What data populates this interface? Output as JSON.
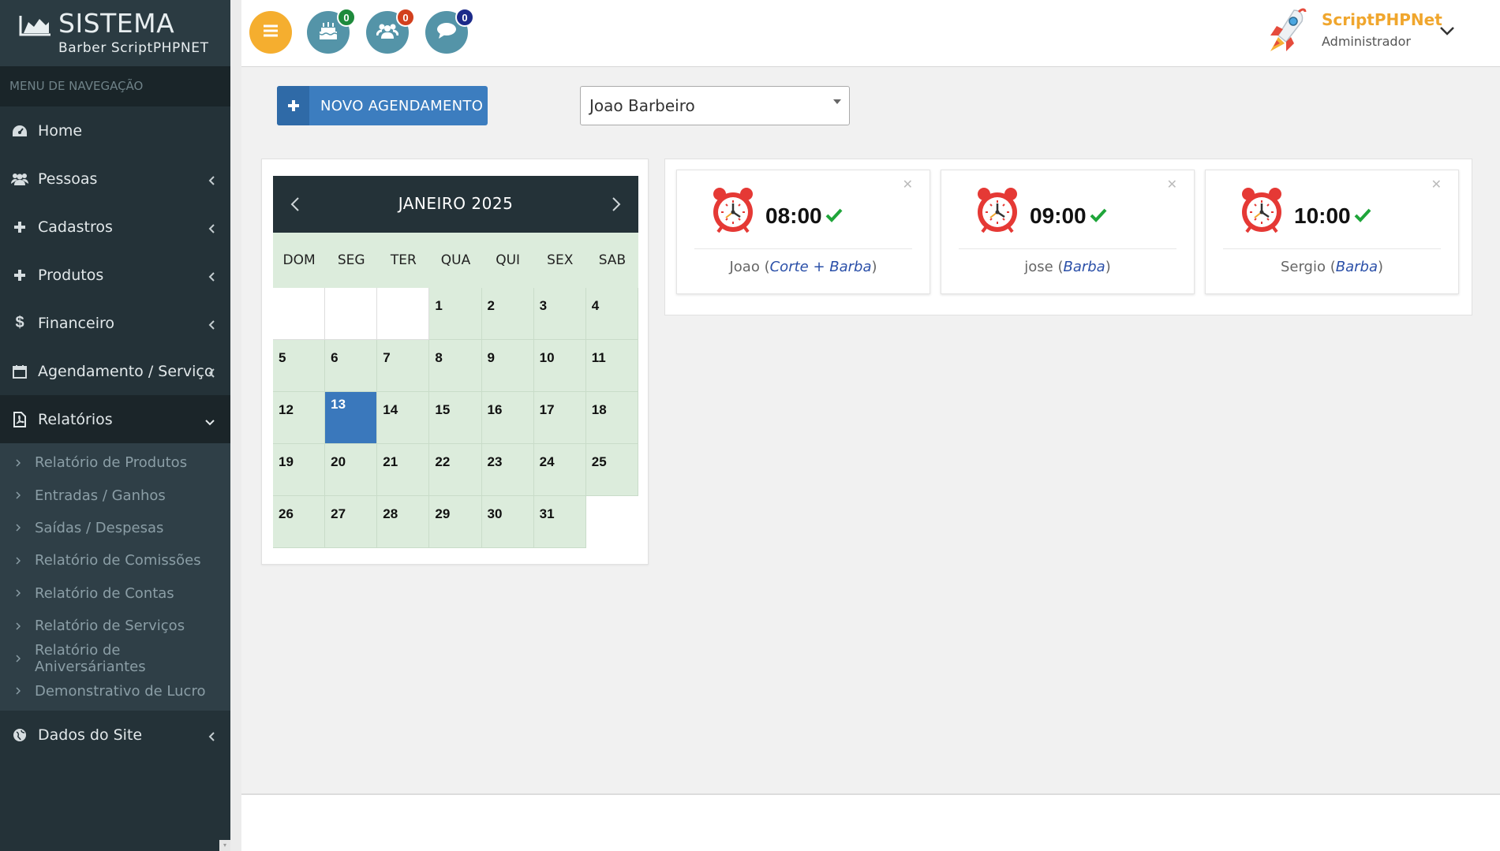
{
  "brand": {
    "title": "SISTEMA",
    "subtitle": "Barber ScriptPHPNET"
  },
  "sidebar": {
    "header": "MENU DE NAVEGAÇÃO",
    "items": [
      {
        "label": "Home",
        "icon": "dashboard-icon"
      },
      {
        "label": "Pessoas",
        "icon": "users-icon"
      },
      {
        "label": "Cadastros",
        "icon": "plus-icon"
      },
      {
        "label": "Produtos",
        "icon": "plus-icon"
      },
      {
        "label": "Financeiro",
        "icon": "dollar-icon"
      },
      {
        "label": "Agendamento / Serviço",
        "icon": "calendar-icon"
      },
      {
        "label": "Relatórios",
        "icon": "pdf-file-icon"
      },
      {
        "label": "Dados do Site",
        "icon": "globe-icon"
      }
    ],
    "submenu": [
      "Relatório de Produtos",
      "Entradas / Ganhos",
      "Saídas / Despesas",
      "Relatório de Comissões",
      "Relatório de Contas",
      "Relatório de Serviços",
      "Relatório de Aniversáriantes",
      "Demonstrativo de Lucro"
    ]
  },
  "topbar": {
    "notifications": [
      {
        "icon": "birthday-cake-icon",
        "count": "0",
        "color": "#1e8a3c"
      },
      {
        "icon": "users-icon",
        "count": "0",
        "color": "#d2401e"
      },
      {
        "icon": "chat-bubble-icon",
        "count": "0",
        "color": "#1c2a8a"
      }
    ],
    "user": {
      "name": "ScriptPHPNet",
      "role": "Administrador"
    }
  },
  "toolbar": {
    "new_button": "NOVO AGENDAMENTO",
    "barber_selected": "Joao Barbeiro"
  },
  "calendar": {
    "month": "JANEIRO 2025",
    "day_names": [
      "DOM",
      "SEG",
      "TER",
      "QUA",
      "QUI",
      "SEX",
      "SAB"
    ],
    "weeks": [
      [
        "",
        "",
        "",
        "1",
        "2",
        "3",
        "4"
      ],
      [
        "5",
        "6",
        "7",
        "8",
        "9",
        "10",
        "11"
      ],
      [
        "12",
        "13",
        "14",
        "15",
        "16",
        "17",
        "18"
      ],
      [
        "19",
        "20",
        "21",
        "22",
        "23",
        "24",
        "25"
      ],
      [
        "26",
        "27",
        "28",
        "29",
        "30",
        "31",
        ""
      ]
    ],
    "selected_day": "13"
  },
  "appointments": [
    {
      "time": "08:00",
      "client": "Joao",
      "service": "Corte + Barba"
    },
    {
      "time": "09:00",
      "client": "jose",
      "service": "Barba"
    },
    {
      "time": "10:00",
      "client": "Sergio",
      "service": "Barba"
    }
  ],
  "colors": {
    "sidebar_bg": "#243238",
    "accent_orange": "#f5ae2f",
    "primary_blue": "#3c7dbf",
    "calendar_cell": "#dcecdc"
  }
}
